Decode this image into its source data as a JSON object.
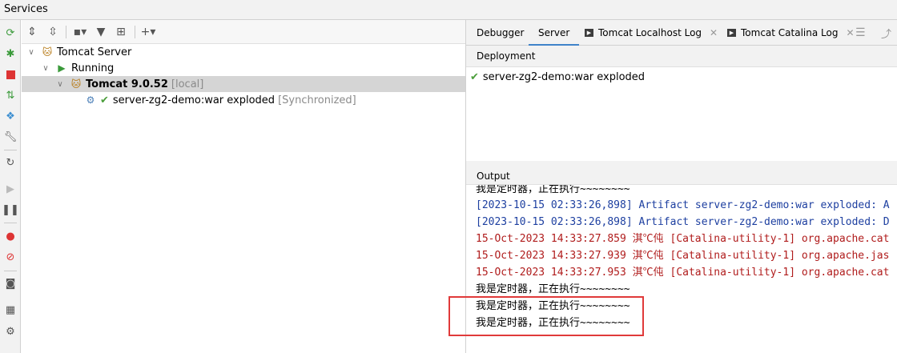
{
  "window": {
    "title": "Services"
  },
  "left_toolbar": {
    "icons": [
      "refresh-icon",
      "debug-icon",
      "stop-icon",
      "deploy-icon",
      "services-icon",
      "wrench-icon",
      "reload-icon",
      "resume-icon",
      "pause-icon",
      "breakpoint-icon",
      "mute-breakpoints-icon",
      "camera-icon",
      "layout-icon",
      "settings-icon"
    ]
  },
  "tree_toolbar": {
    "icons": [
      "expand-all-icon",
      "collapse-all-icon",
      "group-icon",
      "filter-icon",
      "new-tab-icon",
      "add-icon"
    ]
  },
  "tree": {
    "server": "Tomcat Server",
    "state": "Running",
    "instance": {
      "name": "Tomcat 9.0.52",
      "suffix": "[local]"
    },
    "artifact": {
      "name": "server-zg2-demo:war exploded",
      "status": "[Synchronized]"
    }
  },
  "tabs": [
    {
      "label": "Debugger",
      "active": false
    },
    {
      "label": "Server",
      "active": true
    },
    {
      "label": "Tomcat Localhost Log",
      "active": false,
      "closable": true
    },
    {
      "label": "Tomcat Catalina Log",
      "active": false,
      "closable": true
    }
  ],
  "deployment": {
    "header": "Deployment",
    "item": "server-zg2-demo:war exploded"
  },
  "output": {
    "header": "Output",
    "lines": [
      {
        "text": "我是定时器，正在执行~~~~~~~~",
        "color": "#000000"
      },
      {
        "text": "[2023-10-15 02:33:26,898] Artifact server-zg2-demo:war exploded: A",
        "color": "#1d3fa0"
      },
      {
        "text": "[2023-10-15 02:33:26,898] Artifact server-zg2-demo:war exploded: D",
        "color": "#1d3fa0"
      },
      {
        "text": "15-Oct-2023 14:33:27.859 淇℃伅 [Catalina-utility-1] org.apache.cat",
        "color": "#b01c1c"
      },
      {
        "text": "15-Oct-2023 14:33:27.939 淇℃伅 [Catalina-utility-1] org.apache.jas",
        "color": "#b01c1c"
      },
      {
        "text": "15-Oct-2023 14:33:27.953 淇℃伅 [Catalina-utility-1] org.apache.cat",
        "color": "#b01c1c"
      },
      {
        "text": "我是定时器，正在执行~~~~~~~~",
        "color": "#000000"
      },
      {
        "text": "我是定时器，正在执行~~~~~~~~",
        "color": "#000000"
      },
      {
        "text": "我是定时器，正在执行~~~~~~~~",
        "color": "#000000"
      }
    ]
  }
}
